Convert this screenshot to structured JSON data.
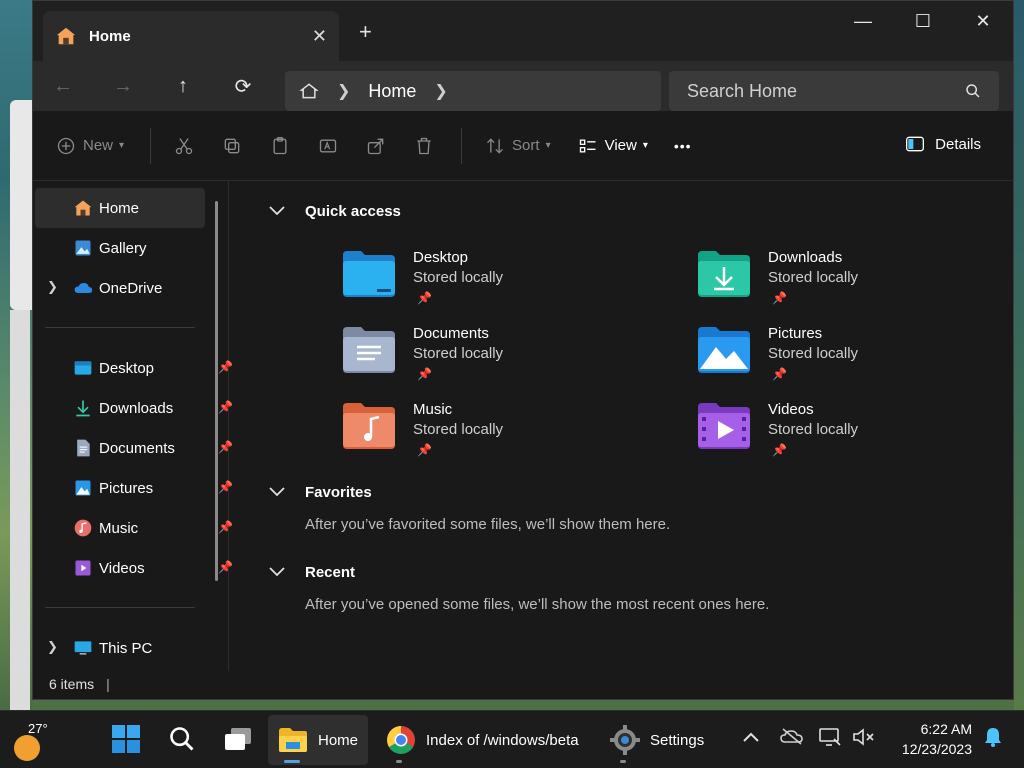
{
  "window": {
    "tab_title": "Home",
    "close_tab": "✕",
    "new_tab": "+",
    "minimize": "—",
    "maximize": "☐",
    "close": "✕"
  },
  "navigation": {
    "back": "←",
    "forward": "→",
    "up": "↑",
    "refresh": "⟳",
    "breadcrumb": [
      "Home"
    ],
    "search_placeholder": "Search Home"
  },
  "commandbar": {
    "new": "New",
    "sort": "Sort",
    "view": "View",
    "more": "•••",
    "details": "Details"
  },
  "sidebar": {
    "items": [
      {
        "label": "Home",
        "icon": "home-icon",
        "selected": true
      },
      {
        "label": "Gallery",
        "icon": "gallery-icon"
      },
      {
        "label": "OneDrive",
        "icon": "onedrive-icon",
        "expandable": true
      }
    ],
    "pinned": [
      {
        "label": "Desktop",
        "icon": "desktop-folder-icon"
      },
      {
        "label": "Downloads",
        "icon": "downloads-folder-icon"
      },
      {
        "label": "Documents",
        "icon": "documents-folder-icon"
      },
      {
        "label": "Pictures",
        "icon": "pictures-folder-icon"
      },
      {
        "label": "Music",
        "icon": "music-folder-icon"
      },
      {
        "label": "Videos",
        "icon": "videos-folder-icon"
      }
    ],
    "this_pc": "This PC"
  },
  "main": {
    "quick_access": {
      "title": "Quick access",
      "items": [
        {
          "name": "Desktop",
          "sub": "Stored locally"
        },
        {
          "name": "Downloads",
          "sub": "Stored locally"
        },
        {
          "name": "Documents",
          "sub": "Stored locally"
        },
        {
          "name": "Pictures",
          "sub": "Stored locally"
        },
        {
          "name": "Music",
          "sub": "Stored locally"
        },
        {
          "name": "Videos",
          "sub": "Stored locally"
        }
      ]
    },
    "favorites": {
      "title": "Favorites",
      "message": "After you’ve favorited some files, we’ll show them here."
    },
    "recent": {
      "title": "Recent",
      "message": "After you’ve opened some files, we’ll show the most recent ones here."
    }
  },
  "statusbar": {
    "count": "6 items"
  },
  "taskbar": {
    "weather_temp": "27°",
    "apps": [
      {
        "label": "Home",
        "icon": "file-explorer-icon",
        "active": true
      },
      {
        "label": "Index of /windows/beta",
        "icon": "chrome-icon"
      },
      {
        "label": "Settings",
        "icon": "settings-gear-icon"
      }
    ],
    "time": "6:22 AM",
    "date": "12/23/2023"
  },
  "colors": {
    "accent": "#4cc2ff",
    "window_bg": "#191919",
    "toolbar_bg": "#2b2b2b"
  }
}
